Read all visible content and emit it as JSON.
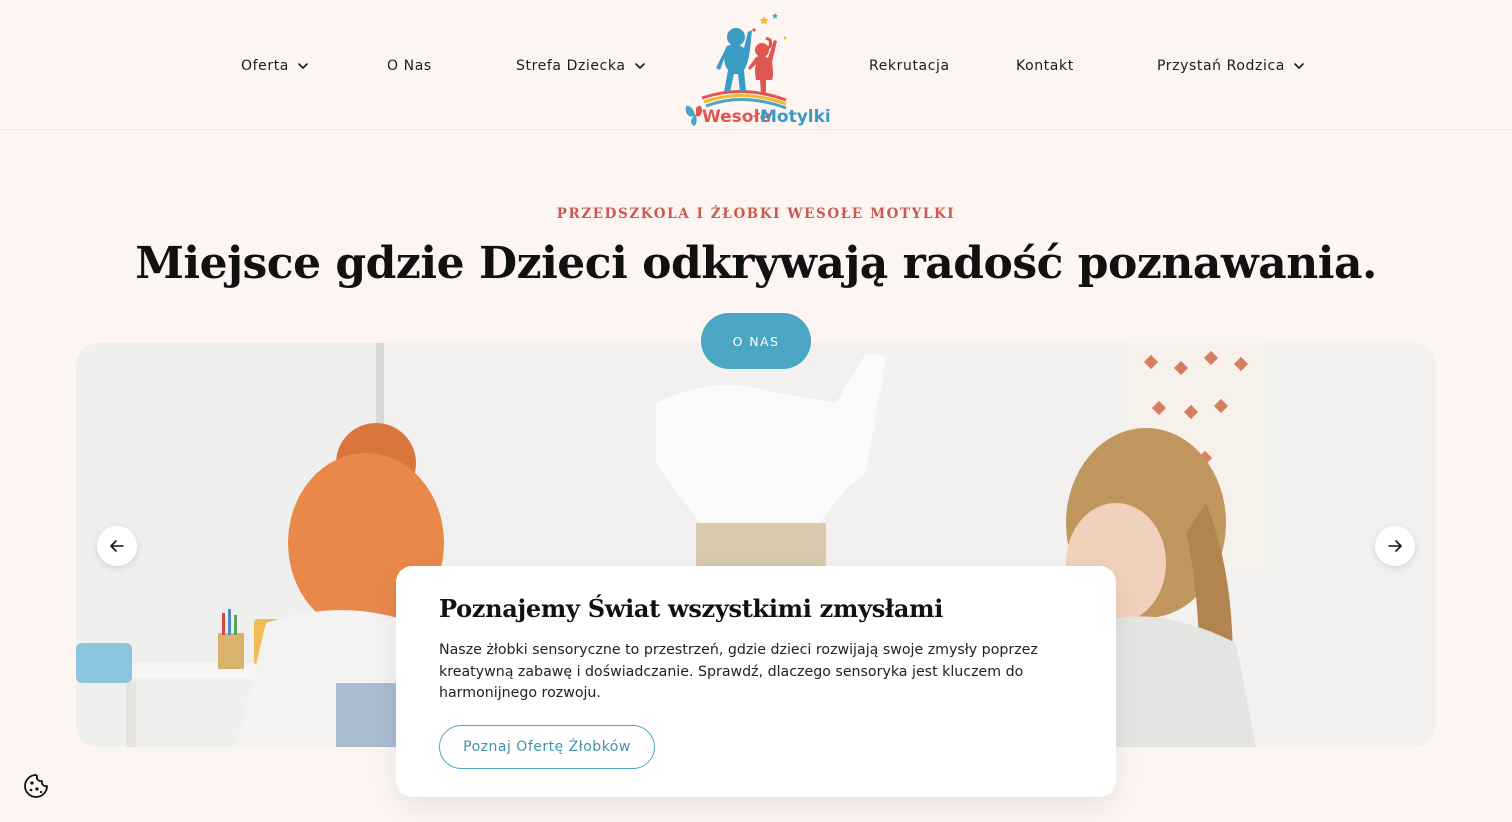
{
  "header": {
    "nav_left": [
      {
        "label": "Oferta",
        "has_dropdown": true
      },
      {
        "label": "O Nas",
        "has_dropdown": false
      },
      {
        "label": "Strefa Dziecka",
        "has_dropdown": true
      }
    ],
    "nav_right": [
      {
        "label": "Rekrutacja",
        "has_dropdown": false
      },
      {
        "label": "Kontakt",
        "has_dropdown": false
      },
      {
        "label": "Przystań Rodzica",
        "has_dropdown": true
      }
    ],
    "logo": {
      "text_part1": "Wesołe",
      "text_part2": "Motylki",
      "color_blue": "#3a9bc4",
      "color_red": "#e0574f"
    }
  },
  "hero": {
    "eyebrow": "PRZEDSZKOLA I ŻŁOBKI WESOŁE MOTYLKI",
    "headline": "Miejsce gdzie Dzieci odkrywają radość poznawania.",
    "pill_label": "O NAS"
  },
  "slider": {
    "prev_icon": "arrow-left-icon",
    "next_icon": "arrow-right-icon",
    "card": {
      "title": "Poznajemy Świat wszystkimi zmysłami",
      "text": "Nasze żłobki sensoryczne to przestrzeń, gdzie dzieci rozwijają swoje zmysły poprzez kreatywną zabawę i doświadczanie. Sprawdź, dlaczego sensoryka jest kluczem do harmonijnego rozwoju.",
      "button_label": "Poznaj Ofertę Żłobków"
    }
  },
  "cookie": {
    "icon": "cookie-icon"
  },
  "colors": {
    "background": "#fdf5f1",
    "accent_blue": "#4aa6c2",
    "eyebrow_red": "#c85a4f"
  }
}
